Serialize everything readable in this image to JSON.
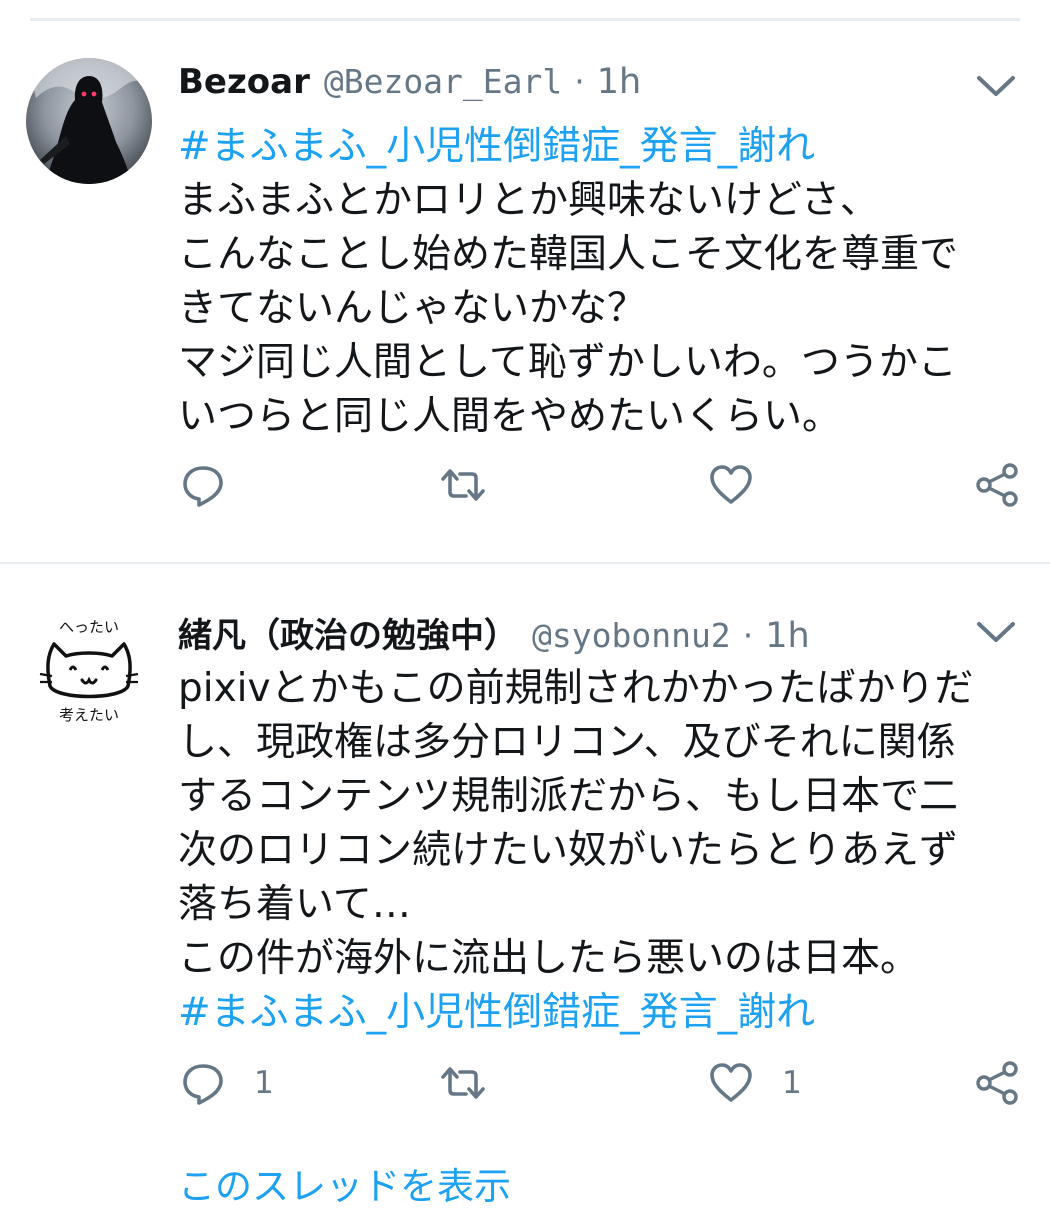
{
  "tweets": [
    {
      "name": "Bezoar",
      "handle": "@Bezoar_Earl",
      "time": "1h",
      "hashtag_top": "#まふまふ_小児性倒錯症_発言_謝れ",
      "text": "まふまふとかロリとか興味ないけどさ、\nこんなことし始めた韓国人こそ文化を尊重で\nきてないんじゃないかな？\nマジ同じ人間として恥ずかしいわ。つうかこ\nいつらと同じ人間をやめたいくらい。",
      "reply_count": "",
      "like_count": ""
    },
    {
      "name": "緒凡（政治の勉強中）",
      "handle": "@syobonnu2",
      "time": "1h",
      "text": "pixivとかもこの前規制されかかったばかりだ\nし、現政権は多分ロリコン、及びそれに関係\nするコンテンツ規制派だから、もし日本で二\n次のロリコン続けたい奴がいたらとりあえず\n落ち着いて…\nこの件が海外に流出したら悪いのは日本。",
      "hashtag_bottom": "#まふまふ_小児性倒錯症_発言_謝れ",
      "reply_count": "1",
      "like_count": "1",
      "avatar_caption_top": "へったい",
      "avatar_caption_bottom": "考えたい"
    }
  ],
  "thread_link": "このスレッドを表示",
  "colors": {
    "link": "#1da1f2",
    "secondary": "#657786",
    "text": "#14171a",
    "divider": "#e6ecf0"
  },
  "icons": [
    "reply-icon",
    "retweet-icon",
    "like-icon",
    "share-icon",
    "chevron-down-icon"
  ]
}
